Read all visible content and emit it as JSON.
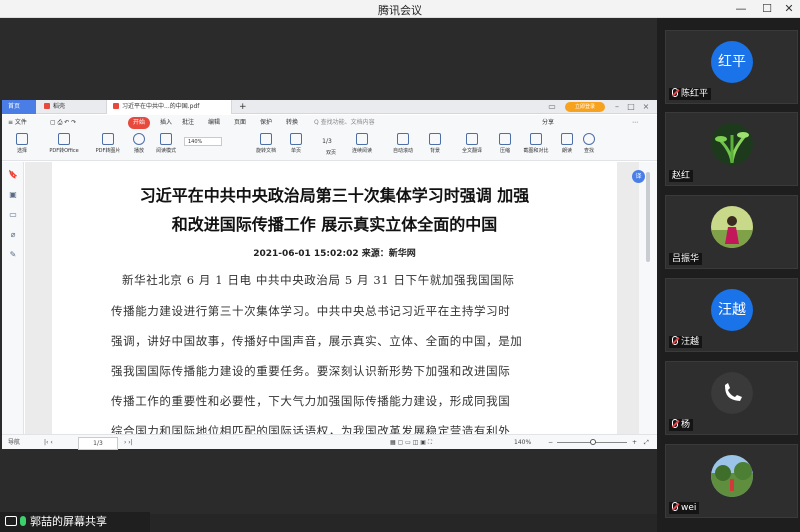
{
  "window": {
    "title": "腾讯会议",
    "minimize_icon": "minimize-icon",
    "maximize_icon": "maximize-icon",
    "close_icon": "close-icon"
  },
  "wps": {
    "tabs": [
      {
        "label": "首页"
      },
      {
        "label": "稻壳"
      },
      {
        "label": "习近平在中共中...的中国.pdf"
      }
    ],
    "login_label": "立即登录",
    "menu": {
      "file": "≡ 文件",
      "start": "开始",
      "insert": "插入",
      "annotate": "批注",
      "edit": "编辑",
      "page": "页面",
      "protect": "保护",
      "convert": "转换",
      "search": "Q 查找功能、文档内容",
      "share": "分享",
      "more": "⋯"
    },
    "toolbar": {
      "tools": [
        {
          "label": "选择"
        },
        {
          "label": "PDF转Office"
        },
        {
          "label": "PDF转图片"
        },
        {
          "label": "播放"
        },
        {
          "label": "阅读模式"
        },
        {
          "label": "旋转文档"
        },
        {
          "label": "单页"
        },
        {
          "label": "双页"
        },
        {
          "label": "连续阅读"
        },
        {
          "label": "自动滚动"
        },
        {
          "label": "背景"
        },
        {
          "label": "全文翻译"
        },
        {
          "label": "压缩"
        },
        {
          "label": "截图和对比"
        },
        {
          "label": "朗读"
        },
        {
          "label": "查找"
        }
      ],
      "zoom": "140%",
      "page": "1/3"
    },
    "document": {
      "title_line1": "习近平在中共中央政治局第三十次集体学习时强调 加强",
      "title_line2": "和改进国际传播工作 展示真实立体全面的中国",
      "meta": "2021-06-01 15:02:02  来源：新华网",
      "lines": [
        "新华社北京 6 月 1 日电  中共中央政治局 5 月 31 日下午就加强我国国际",
        "传播能力建设进行第三十次集体学习。中共中央总书记习近平在主持学习时",
        "强调，讲好中国故事，传播好中国声音，展示真实、立体、全面的中国，是加",
        "强我国国际传播能力建设的重要任务。要深刻认识新形势下加强和改进国际",
        "传播工作的重要性和必要性，下大气力加强国际传播能力建设，形成同我国",
        "综合国力和国际地位相匹配的国际话语权，为我国改革发展稳定营造有利外"
      ]
    },
    "statusbar": {
      "nav": "导航",
      "page": "1/3",
      "zoom": "140%",
      "zoom_minus": "−",
      "zoom_plus": "+"
    }
  },
  "share_indicator": {
    "label": "郭喆的屏幕共享"
  },
  "participants": [
    {
      "name": "陈红平",
      "avatar_text": "红平",
      "avatar_color": "#1a73e8",
      "muted": true
    },
    {
      "name": "赵红",
      "avatar_kind": "plant-photo",
      "muted": false
    },
    {
      "name": "吕振华",
      "avatar_kind": "person-photo",
      "muted": false
    },
    {
      "name": "汪越",
      "avatar_text": "汪越",
      "avatar_color": "#1a73e8",
      "muted": true
    },
    {
      "name": "杨",
      "avatar_kind": "phone-icon",
      "muted": true
    },
    {
      "name": "wei",
      "avatar_kind": "landscape-photo",
      "muted": true
    }
  ],
  "colors": {
    "brand_blue": "#1a73e8",
    "wps_red": "#e8493d",
    "mic_green": "#3ecf6d"
  }
}
